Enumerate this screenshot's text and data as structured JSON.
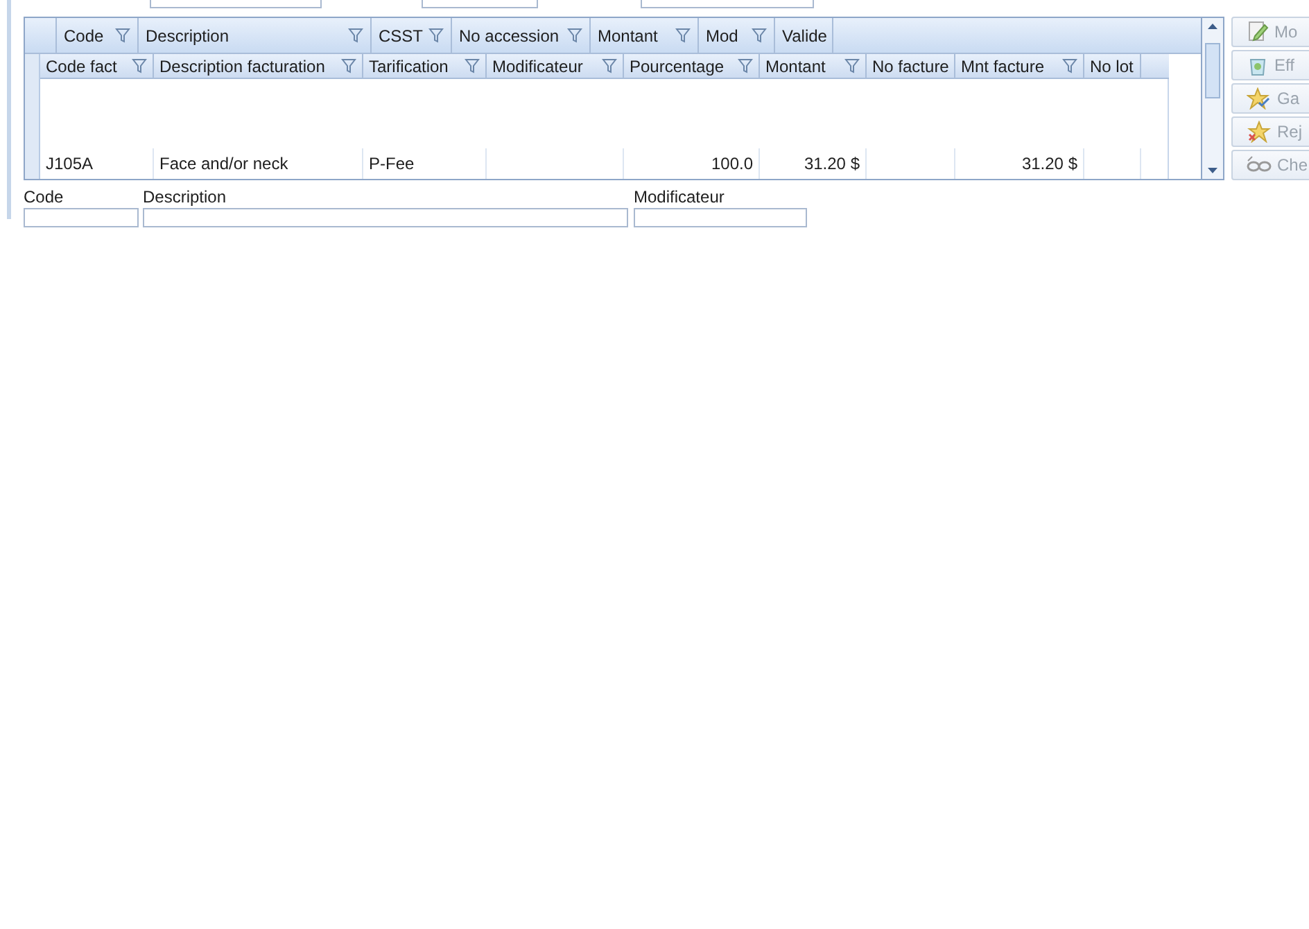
{
  "outer_grid": {
    "columns": [
      {
        "label": "Code"
      },
      {
        "label": "Description"
      },
      {
        "label": "CSST"
      },
      {
        "label": "No accession"
      },
      {
        "label": "Montant"
      },
      {
        "label": "Mod"
      },
      {
        "label": "Valide",
        "filter": false
      }
    ]
  },
  "inner_grid": {
    "columns": [
      {
        "label": "Code fact"
      },
      {
        "label": "Description facturation"
      },
      {
        "label": "Tarification"
      },
      {
        "label": "Modificateur"
      },
      {
        "label": "Pourcentage"
      },
      {
        "label": "Montant"
      },
      {
        "label": "No facture",
        "filter": false
      },
      {
        "label": "Mnt facture"
      },
      {
        "label": "No lot",
        "filter": false
      }
    ],
    "rows": [
      {
        "cells": [
          "J105A",
          "Face and/or neck",
          "P-Fee",
          "",
          "100.0",
          "31.20 $",
          "",
          "31.20 $",
          ""
        ]
      }
    ]
  },
  "form": {
    "fields": [
      {
        "label": "Code"
      },
      {
        "label": "Description"
      },
      {
        "label": "Modificateur"
      }
    ]
  },
  "actions": [
    {
      "kind": "edit",
      "label": "Mo",
      "disabled": true
    },
    {
      "kind": "delete",
      "label": "Eff",
      "disabled": true
    },
    {
      "kind": "star-check",
      "label": "Ga",
      "disabled": true
    },
    {
      "kind": "star-x",
      "label": "Rej",
      "disabled": true
    },
    {
      "kind": "glasses",
      "label": "Che",
      "disabled": true
    }
  ]
}
